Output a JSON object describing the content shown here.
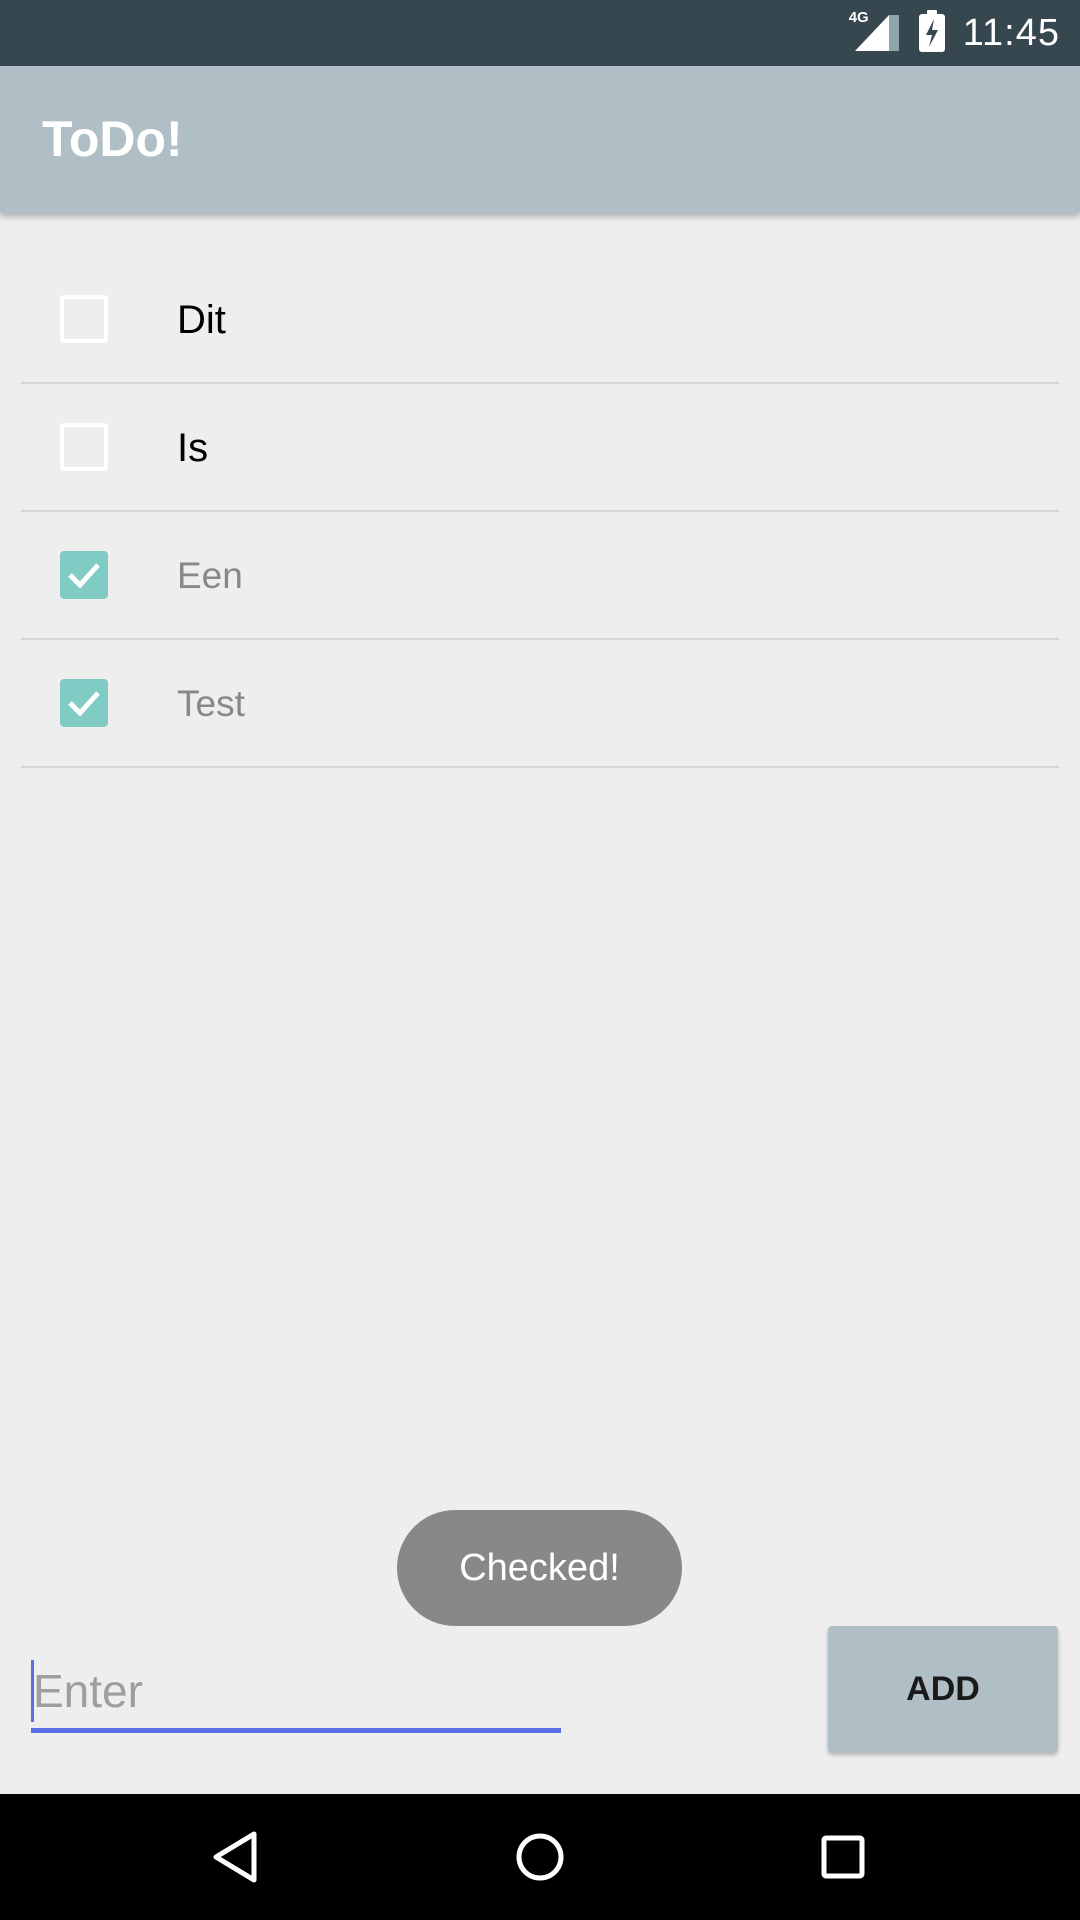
{
  "status_bar": {
    "network": "4G",
    "time": "11:45"
  },
  "app_bar": {
    "title": "ToDo!"
  },
  "todo_items": [
    {
      "label": "Dit",
      "checked": false
    },
    {
      "label": "Is",
      "checked": false
    },
    {
      "label": "Een",
      "checked": true
    },
    {
      "label": "Test",
      "checked": true
    }
  ],
  "toast": {
    "text": "Checked!"
  },
  "input": {
    "placeholder": "Enter",
    "value": ""
  },
  "add_button": {
    "label": "ADD"
  },
  "nav_bar": {
    "icons": [
      "back-icon",
      "home-icon",
      "recents-icon"
    ]
  },
  "colors": {
    "status_bar": "#37474f",
    "app_bar": "#b0bec5",
    "checked_box": "#80cbc4",
    "accent": "#5a6ee6",
    "toast": "#888888"
  }
}
